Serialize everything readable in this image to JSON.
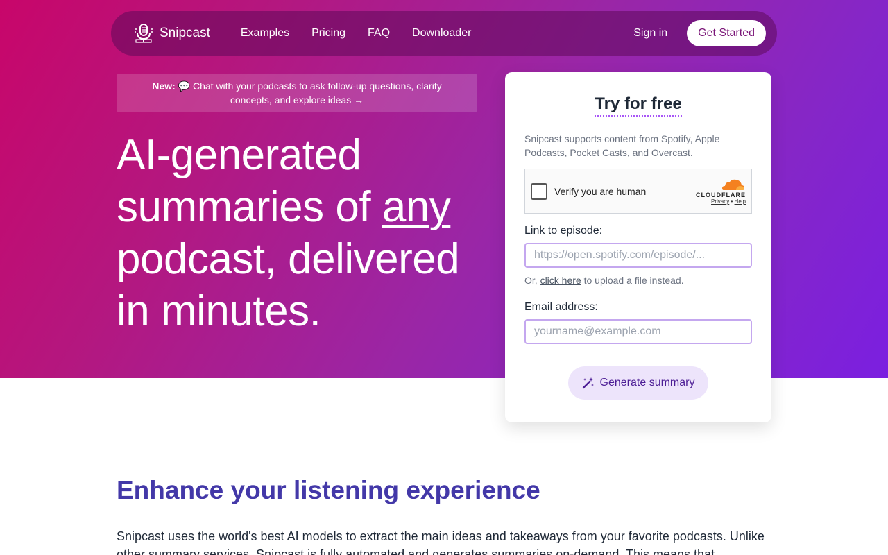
{
  "nav": {
    "brand": "Snipcast",
    "links": [
      "Examples",
      "Pricing",
      "FAQ",
      "Downloader"
    ],
    "sign_in": "Sign in",
    "get_started": "Get Started"
  },
  "announcement": {
    "label": "New:",
    "emoji": "💬",
    "text": "Chat with your podcasts to ask follow-up questions, clarify concepts, and explore ideas →"
  },
  "hero": {
    "line1": "AI-generated",
    "line2_pre": "summaries of ",
    "line2_underlined": "any",
    "line3": "podcast, delivered",
    "line4": "in minutes."
  },
  "card": {
    "title": "Try for free",
    "supported_note": "Snipcast supports content from Spotify, Apple Podcasts, Pocket Casts, and Overcast.",
    "captcha": {
      "label": "Verify you are human",
      "brand": "CLOUDFLARE",
      "privacy": "Privacy",
      "separator": "•",
      "help": "Help"
    },
    "episode_label": "Link to episode:",
    "episode_placeholder": "https://open.spotify.com/episode/...",
    "upload_prefix": "Or, ",
    "upload_link": "click here",
    "upload_suffix": " to upload a file instead.",
    "email_label": "Email address:",
    "email_placeholder": "yourname@example.com",
    "generate_button": "Generate summary"
  },
  "features": {
    "title": "Enhance your listening experience",
    "body": "Snipcast uses the world's best AI models to extract the main ideas and takeaways from your favorite podcasts. Unlike other summary services, Snipcast is fully automated and generates summaries on-demand. This means that"
  },
  "colors": {
    "accent": "#4338a8",
    "button_bg": "#ede4fb",
    "cloudflare_orange": "#f48120"
  },
  "icons": {
    "logo": "microphone-logo-icon",
    "generate": "magic-wand-icon",
    "cloudflare": "cloudflare-cloud-icon"
  }
}
